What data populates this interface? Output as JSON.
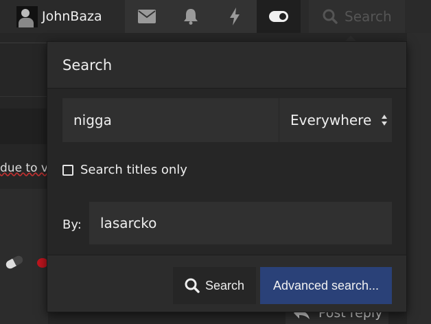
{
  "nav": {
    "username": "JohnBaza",
    "icons": [
      "envelope-icon",
      "bell-icon",
      "bolt-icon",
      "toggle-icon",
      "search-icon"
    ],
    "search_placeholder": "Search"
  },
  "background": {
    "partial_text": "due to v",
    "post_reply_label": "Post reply"
  },
  "search_panel": {
    "title": "Search",
    "query_value": "nigga",
    "scope_selected": "Everywhere",
    "titles_only_label": "Search titles only",
    "titles_only_checked": false,
    "by_label": "By:",
    "by_value": "lasarcko",
    "search_button_label": "Search",
    "advanced_button_label": "Advanced search..."
  },
  "colors": {
    "accent": "#2a4178",
    "panel_bg": "#262626",
    "header_bg": "#2c2c2c",
    "input_bg": "#303030",
    "spellcheck_underline": "#c03030"
  }
}
